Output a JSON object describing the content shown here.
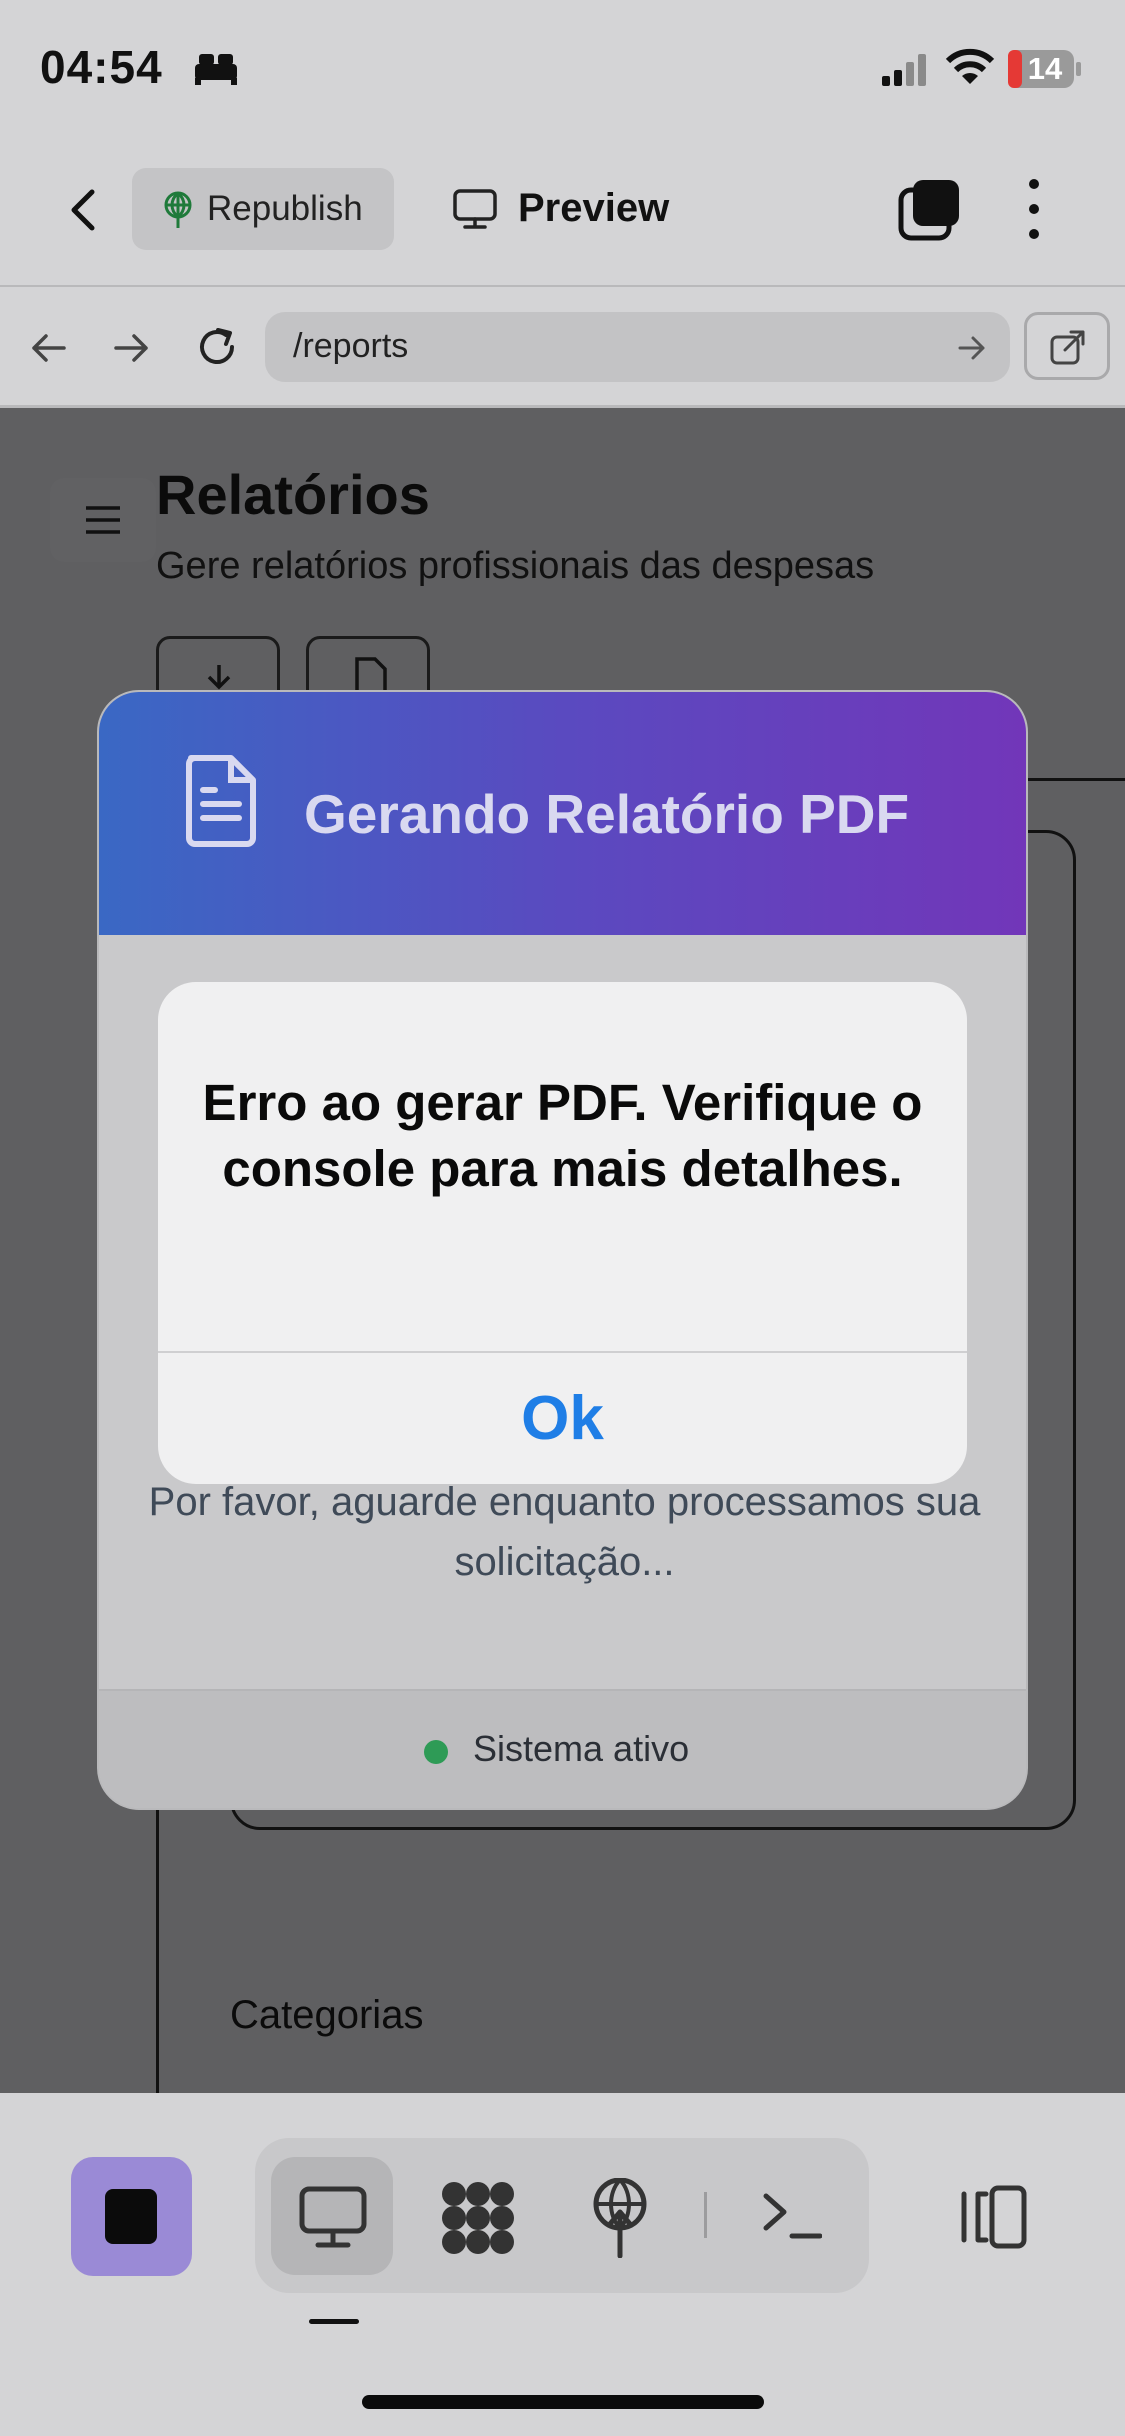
{
  "status_bar": {
    "time": "04:54",
    "battery": "14"
  },
  "toolbar": {
    "republish_label": "Republish",
    "preview_label": "Preview"
  },
  "browser": {
    "url": "/reports"
  },
  "page": {
    "title": "Relatórios",
    "subtitle": "Gere relatórios profissionais das despesas",
    "section_label": "Categorias"
  },
  "modal": {
    "title": "Gerando Relatório PDF",
    "message": "Por favor, aguarde enquanto processamos sua solicitação...",
    "status_text": "Sistema ativo",
    "status_color": "#2e9b56"
  },
  "alert": {
    "message": "Erro ao gerar PDF. Verifique o console para mais detalhes.",
    "ok_label": "Ok"
  },
  "dock": {
    "tabs": [
      "desktop-preview-icon",
      "apps-grid-icon",
      "deploy-icon",
      "terminal-icon"
    ]
  }
}
